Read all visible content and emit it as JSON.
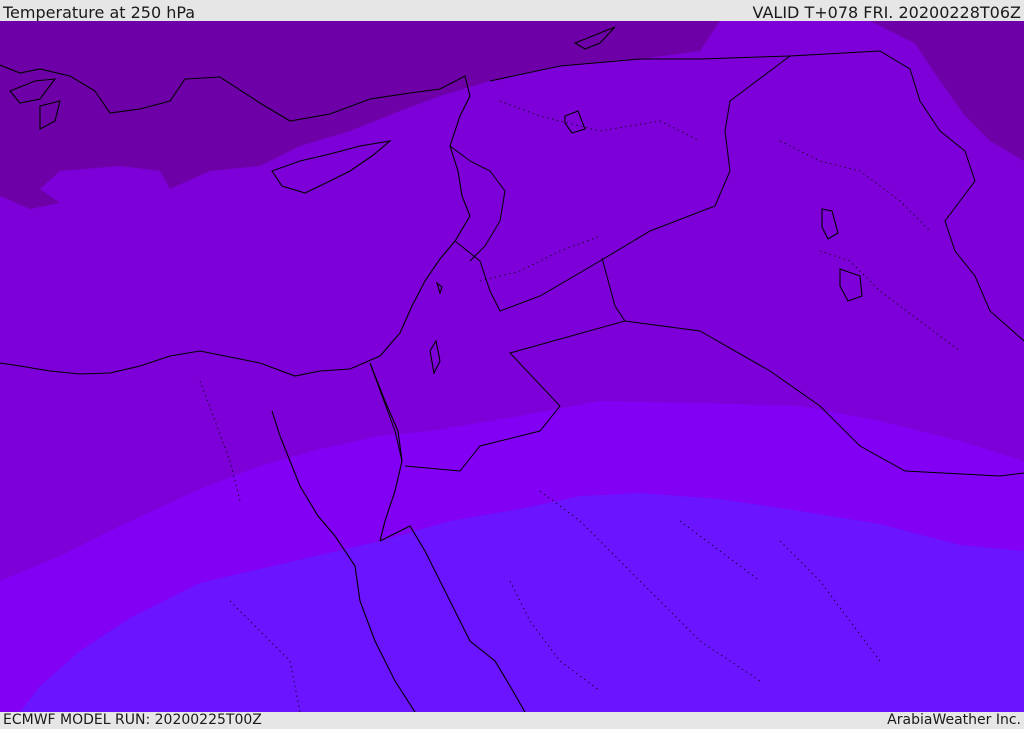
{
  "header": {
    "title": "Temperature at 250 hPa",
    "valid": "VALID T+078 FRI. 20200228T06Z"
  },
  "footer": {
    "model_run": "ECMWF MODEL RUN: 20200225T00Z",
    "credit": "ArabiaWeather Inc."
  },
  "map": {
    "field": "temperature",
    "level": "250 hPa",
    "bands": [
      {
        "name": "band-coldest",
        "color": "#5e0092"
      },
      {
        "name": "band-cold",
        "color": "#6e00a8"
      },
      {
        "name": "band-mid-cold",
        "color": "#7a0cba"
      },
      {
        "name": "band-mid",
        "color": "#7e00d8"
      },
      {
        "name": "band-mid-warm",
        "color": "#8200f4"
      },
      {
        "name": "band-warm",
        "color": "#6a14ff"
      }
    ],
    "coastline_color": "#000000",
    "border_style": "solid",
    "admin_border_style": "dotted"
  }
}
